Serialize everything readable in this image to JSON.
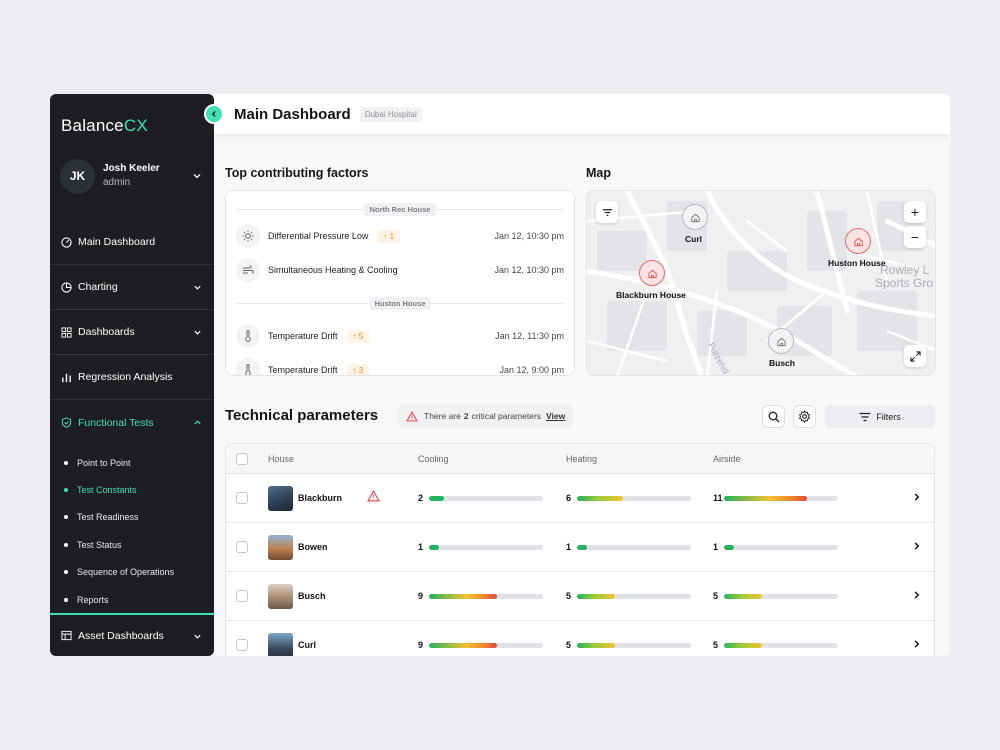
{
  "app": {
    "logo_main": "Balance",
    "logo_accent": "CX"
  },
  "user": {
    "initials": "JK",
    "name": "Josh Keeler",
    "role": "admin"
  },
  "nav": {
    "items": [
      {
        "label": "Main Dashboard",
        "icon": "gauge-icon"
      },
      {
        "label": "Charting",
        "icon": "pie-chart-icon"
      },
      {
        "label": "Dashboards",
        "icon": "grid-icon"
      },
      {
        "label": "Regression Analysis",
        "icon": "bar-chart-icon"
      },
      {
        "label": "Functional Tests",
        "icon": "shield-check-icon"
      }
    ],
    "sub_items": [
      "Point to Point",
      "Test Constants",
      "Test Readiness",
      "Test Status",
      "Sequence of Operations",
      "Reports"
    ],
    "active_sub": "Test Constants",
    "asset_label": "Asset Dashboards"
  },
  "header": {
    "title": "Main Dashboard",
    "tag": "Dubai Hospital"
  },
  "factors": {
    "title": "Top contributing factors",
    "groups": [
      {
        "name": "North Rec House",
        "rows": [
          {
            "label": "Differential Pressure Low",
            "count": "1",
            "time": "Jan 12, 10:30 pm",
            "icon": "sun-icon"
          },
          {
            "label": "Simultaneous Heating & Cooling",
            "count": "",
            "time": "Jan 12, 10:30 pm",
            "icon": "wind-icon"
          }
        ]
      },
      {
        "name": "Huston House",
        "rows": [
          {
            "label": "Temperature Drift",
            "count": "5",
            "time": "Jan 12, 11:30 pm",
            "icon": "thermometer-icon"
          },
          {
            "label": "Temperature Drift",
            "count": "3",
            "time": "Jan 12, 9:00 pm",
            "icon": "thermometer-icon"
          }
        ]
      }
    ]
  },
  "map": {
    "title": "Map",
    "pins": [
      "Curl",
      "Huston House",
      "Blackburn House",
      "Busch"
    ],
    "street_labels": [
      "Rowley L",
      "Sports Gro",
      "Furzehill R"
    ]
  },
  "params": {
    "title": "Technical parameters",
    "alert_prefix": "There are",
    "alert_count": "2",
    "alert_suffix": "critical parameters",
    "alert_link": "View",
    "filters_label": "Filters",
    "columns": [
      "House",
      "Cooling",
      "Heating",
      "Airside"
    ],
    "rows": [
      {
        "house": "Blackburn",
        "warning": true,
        "cooling": 2,
        "heating": 6,
        "airside": 11
      },
      {
        "house": "Bowen",
        "warning": false,
        "cooling": 1,
        "heating": 1,
        "airside": 1
      },
      {
        "house": "Busch",
        "warning": false,
        "cooling": 9,
        "heating": 5,
        "airside": 5
      },
      {
        "house": "Curl",
        "warning": false,
        "cooling": 9,
        "heating": 5,
        "airside": 5
      }
    ]
  },
  "colors": {
    "accent": "#3fe0b1",
    "sidebar": "#1c1e21",
    "warning": "#e05252",
    "badge": "#e88f24"
  }
}
